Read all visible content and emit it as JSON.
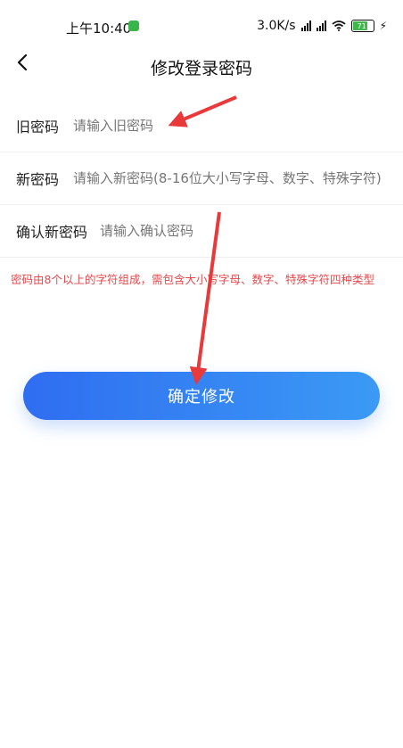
{
  "status_bar": {
    "time": "上午10:40",
    "network_speed": "3.0K/s",
    "battery_level": "71"
  },
  "header": {
    "title": "修改登录密码"
  },
  "form": {
    "old_password": {
      "label": "旧密码",
      "placeholder": "请输入旧密码"
    },
    "new_password": {
      "label": "新密码",
      "placeholder": "请输入新密码(8-16位大小写字母、数字、特殊字符)"
    },
    "confirm_password": {
      "label": "确认新密码",
      "placeholder": "请输入确认密码"
    }
  },
  "hint": "密码由8个以上的字符组成，需包含大小写字母、数字、特殊字符四种类型",
  "submit_label": "确定修改",
  "colors": {
    "accent_start": "#2f6df1",
    "accent_end": "#3b9af5",
    "hint_red": "#e5484d",
    "annotation_arrow": "#e8393b"
  }
}
